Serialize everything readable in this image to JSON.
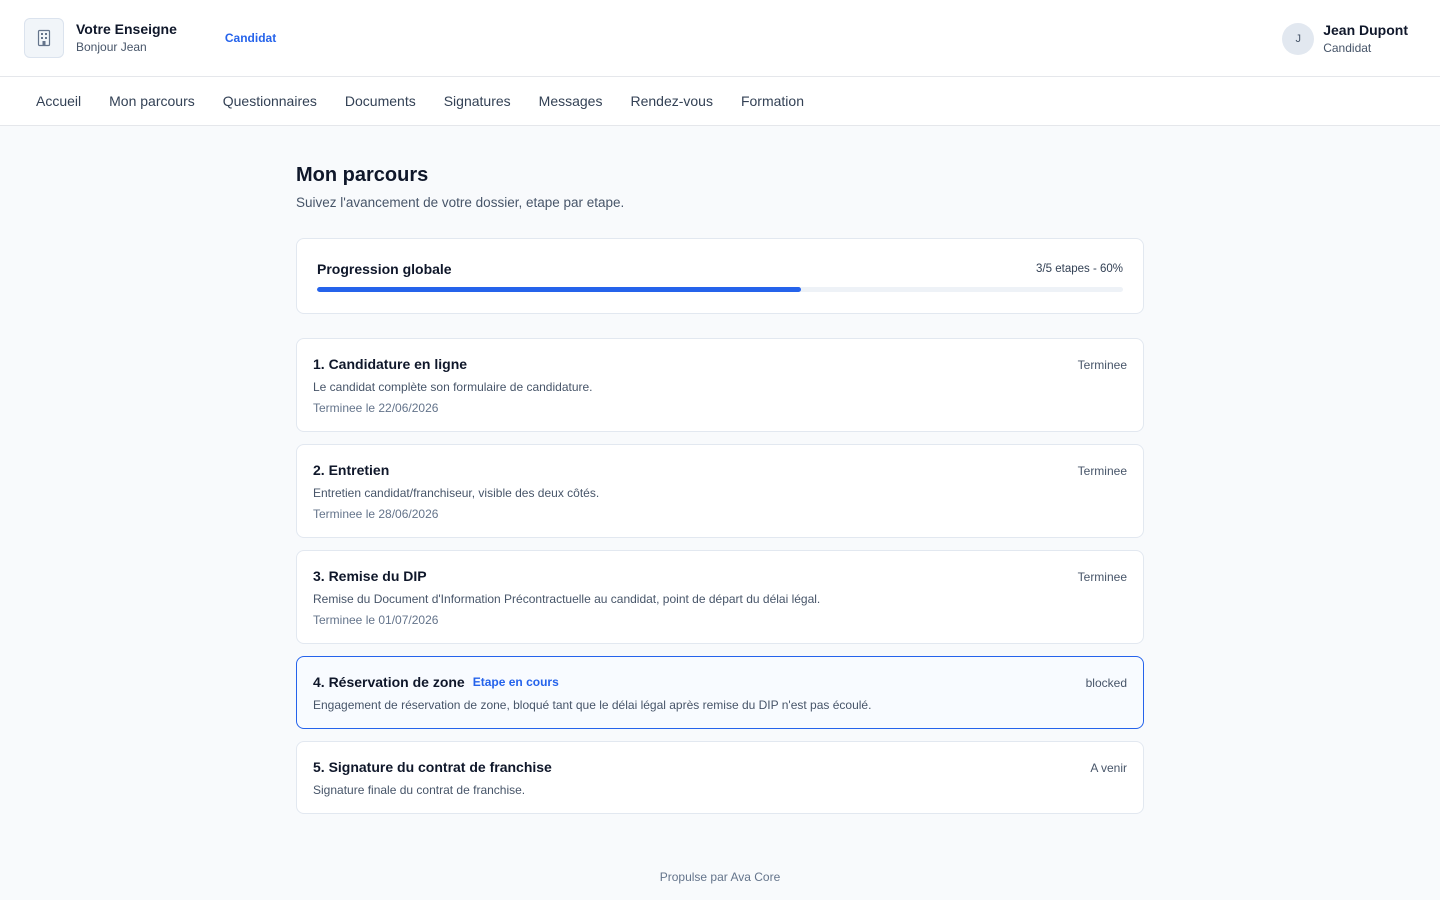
{
  "header": {
    "brand_name": "Votre Enseigne",
    "greeting": "Bonjour Jean",
    "role_link": "Candidat",
    "logo_icon": "building-icon"
  },
  "user": {
    "initial": "J",
    "name": "Jean Dupont",
    "role": "Candidat"
  },
  "nav": {
    "items": [
      {
        "label": "Accueil"
      },
      {
        "label": "Mon parcours"
      },
      {
        "label": "Questionnaires"
      },
      {
        "label": "Documents"
      },
      {
        "label": "Signatures"
      },
      {
        "label": "Messages"
      },
      {
        "label": "Rendez-vous"
      },
      {
        "label": "Formation"
      }
    ]
  },
  "page": {
    "title": "Mon parcours",
    "subtitle": "Suivez l'avancement de votre dossier, etape par etape."
  },
  "progress": {
    "label": "Progression globale",
    "count_text": "3/5 etapes - 60%",
    "percent": 60,
    "accent_color": "#2563eb"
  },
  "steps": [
    {
      "title": "1. Candidature en ligne",
      "status": "Terminee",
      "description": "Le candidat complète son formulaire de candidature.",
      "date": "Terminee le 22/06/2026"
    },
    {
      "title": "2. Entretien",
      "status": "Terminee",
      "description": "Entretien candidat/franchiseur, visible des deux côtés.",
      "date": "Terminee le 28/06/2026"
    },
    {
      "title": "3. Remise du DIP",
      "status": "Terminee",
      "description": "Remise du Document d'Information Précontractuelle au candidat, point de départ du délai légal.",
      "date": "Terminee le 01/07/2026"
    },
    {
      "title": "4. Réservation de zone",
      "badge": "Etape en cours",
      "status": "blocked",
      "description": "Engagement de réservation de zone, bloqué tant que le délai légal après remise du DIP n'est pas écoulé."
    },
    {
      "title": "5. Signature du contrat de franchise",
      "status": "A venir",
      "description": "Signature finale du contrat de franchise."
    }
  ],
  "footer": {
    "text": "Propulse par Ava Core"
  }
}
